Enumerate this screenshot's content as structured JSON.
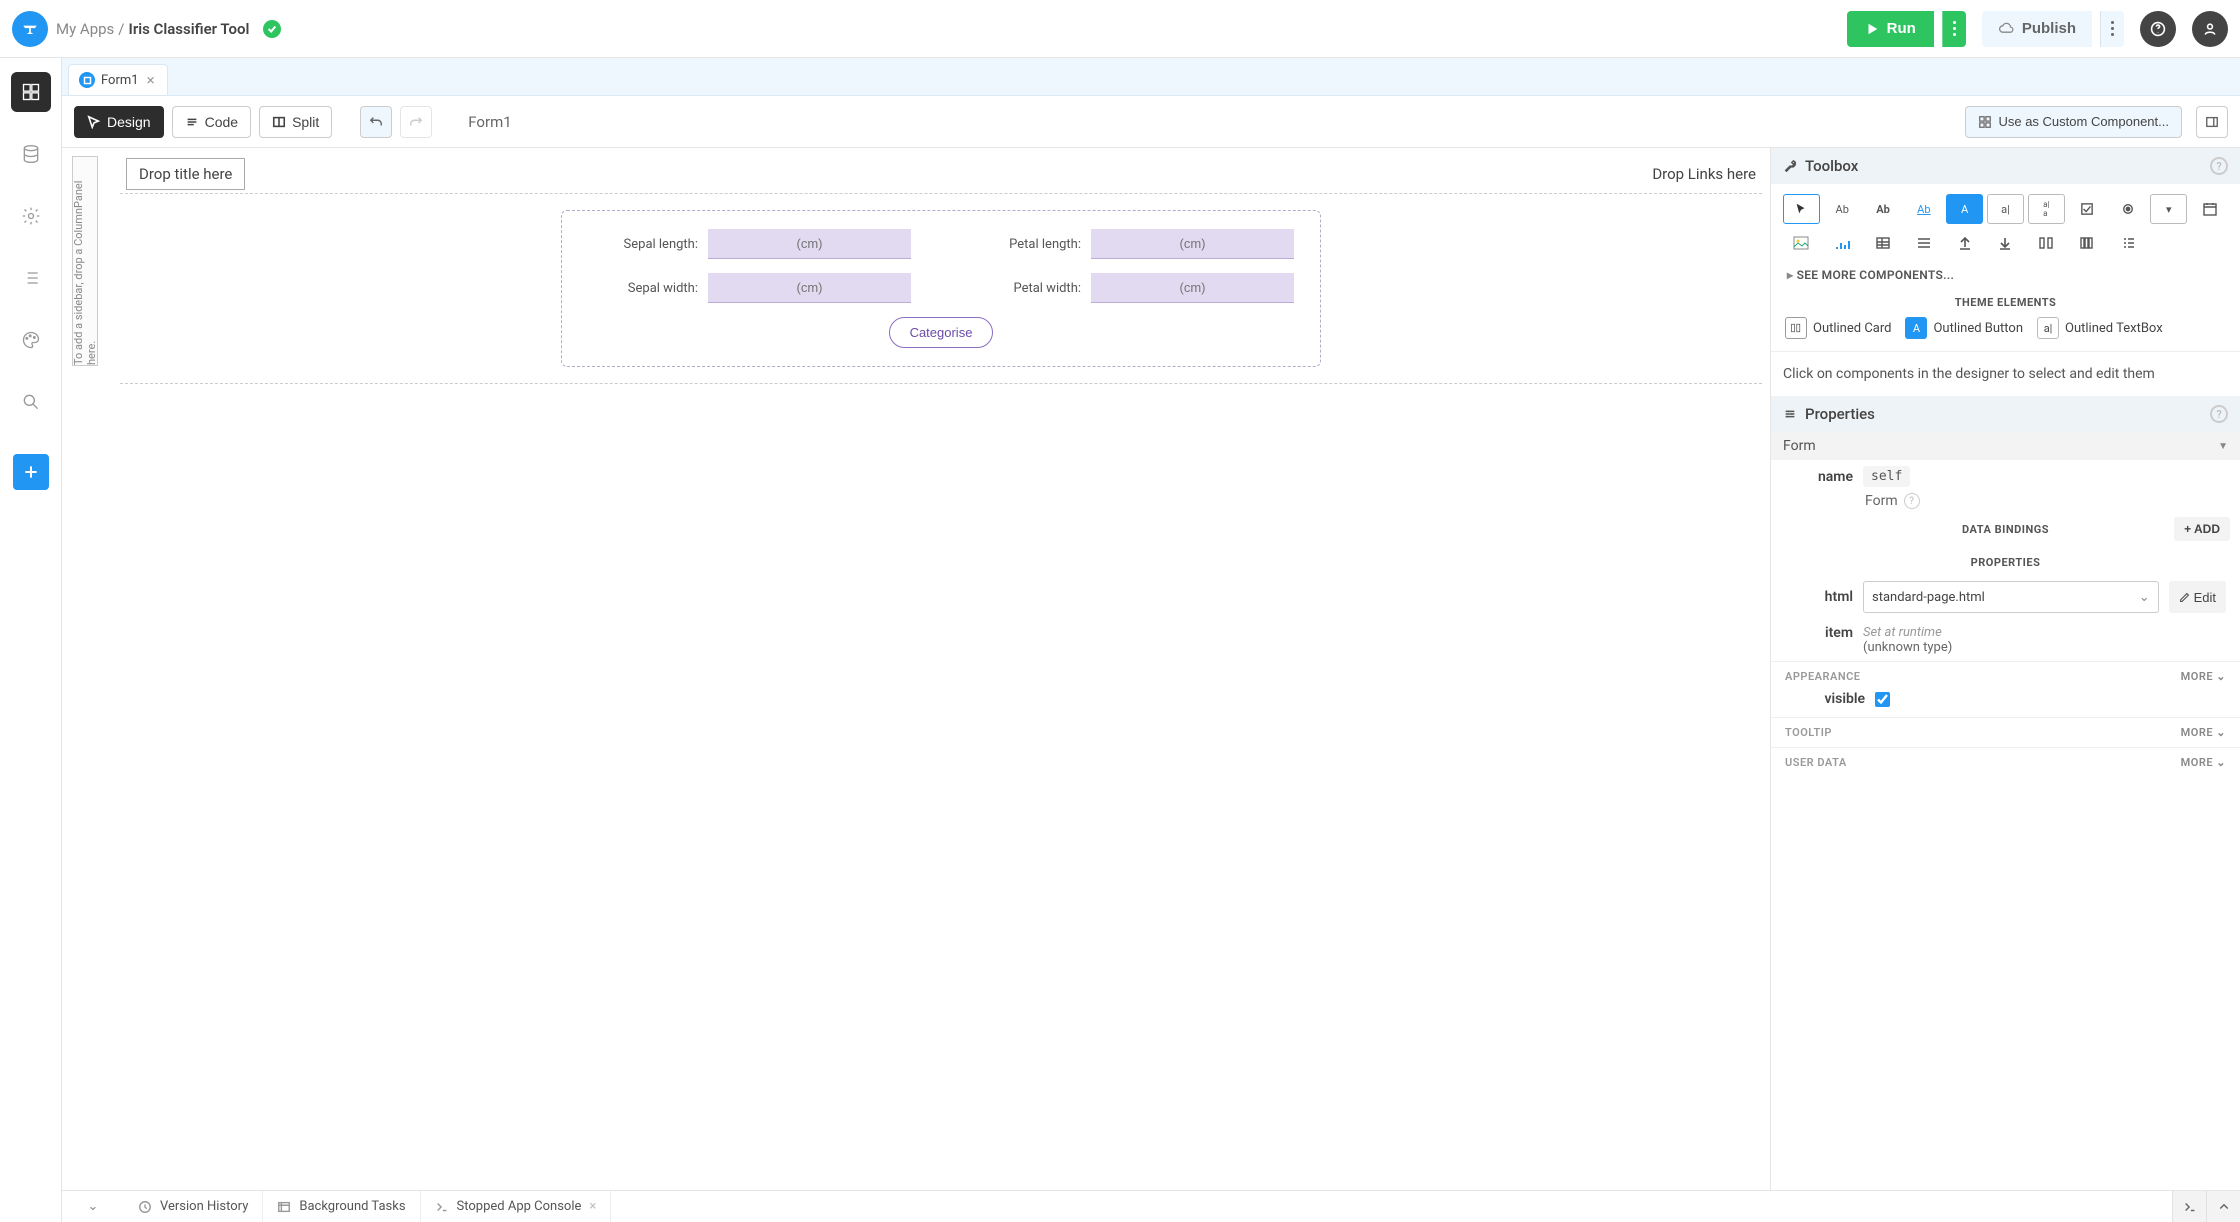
{
  "breadcrumb": {
    "parent": "My Apps",
    "sep": "/",
    "current": "Iris Classifier Tool"
  },
  "topbar": {
    "run": "Run",
    "publish": "Publish"
  },
  "rail": {
    "items": [
      "app-browser",
      "database",
      "settings",
      "outline",
      "theme",
      "search"
    ]
  },
  "tabs": [
    {
      "label": "Form1"
    }
  ],
  "mode": {
    "design": "Design",
    "code": "Code",
    "split": "Split",
    "form_title": "Form1",
    "custom": "Use as Custom Component..."
  },
  "canvas": {
    "sidebar_hint": "To add a sidebar, drop a ColumnPanel here.",
    "drop_title": "Drop title here",
    "drop_links": "Drop Links here",
    "fields": {
      "sepal_length": {
        "label": "Sepal length:",
        "placeholder": "(cm)"
      },
      "sepal_width": {
        "label": "Sepal width:",
        "placeholder": "(cm)"
      },
      "petal_length": {
        "label": "Petal length:",
        "placeholder": "(cm)"
      },
      "petal_width": {
        "label": "Petal width:",
        "placeholder": "(cm)"
      }
    },
    "button": "Categorise"
  },
  "toolbox": {
    "title": "Toolbox",
    "more": "SEE MORE COMPONENTS...",
    "theme_title": "THEME ELEMENTS",
    "theme_els": {
      "card": "Outlined Card",
      "button": "Outlined Button",
      "textbox": "Outlined TextBox"
    },
    "hint": "Click on components in the designer to select and edit them"
  },
  "properties": {
    "title": "Properties",
    "section": "Form",
    "name_label": "name",
    "name_value": "self",
    "type": "Form",
    "bindings_title": "DATA BINDINGS",
    "add": "+ ADD",
    "props_title": "PROPERTIES",
    "html_label": "html",
    "html_value": "standard-page.html",
    "edit": "Edit",
    "item_label": "item",
    "item_hint": "Set at runtime",
    "item_type": "(unknown type)",
    "appearance": "APPEARANCE",
    "visible_label": "visible",
    "tooltip": "TOOLTIP",
    "user_data": "USER DATA",
    "more": "MORE"
  },
  "footer": {
    "version": "Version History",
    "bg": "Background Tasks",
    "console": "Stopped App Console"
  }
}
